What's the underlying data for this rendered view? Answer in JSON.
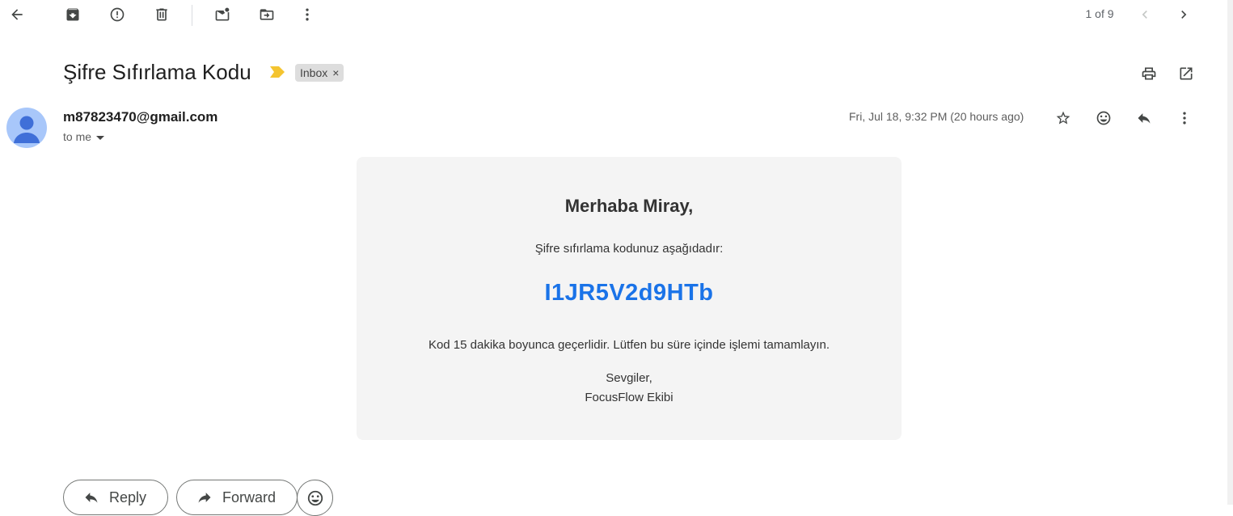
{
  "toolbar": {
    "back_icon": "arrow-left-icon",
    "archive_icon": "archive-icon",
    "spam_icon": "report-spam-icon",
    "delete_icon": "trash-icon",
    "unread_icon": "mark-unread-icon",
    "move_icon": "move-to-folder-icon",
    "more_icon": "more-vert-icon",
    "pager_text": "1 of 9"
  },
  "message": {
    "subject": "Şifre Sıfırlama Kodu",
    "label": "Inbox",
    "label_remove": "×",
    "sender": "m87823470@gmail.com",
    "recipient": "to me",
    "date": "Fri, Jul 18, 9:32 PM (20 hours ago)"
  },
  "body": {
    "greeting": "Merhaba Miray,",
    "intro": "Şifre sıfırlama kodunuz aşağıdadır:",
    "code": "I1JR5V2d9HTb",
    "validity": "Kod 15 dakika boyunca geçerlidir. Lütfen bu süre içinde işlemi tamamlayın.",
    "signoff": "Sevgiler,",
    "team": "FocusFlow Ekibi"
  },
  "actions": {
    "reply_label": "Reply",
    "forward_label": "Forward"
  },
  "colors": {
    "code": "#1a73e8",
    "card_bg": "#f4f4f4",
    "important_marker": "#f4c430",
    "avatar": "#a8c7fa"
  }
}
